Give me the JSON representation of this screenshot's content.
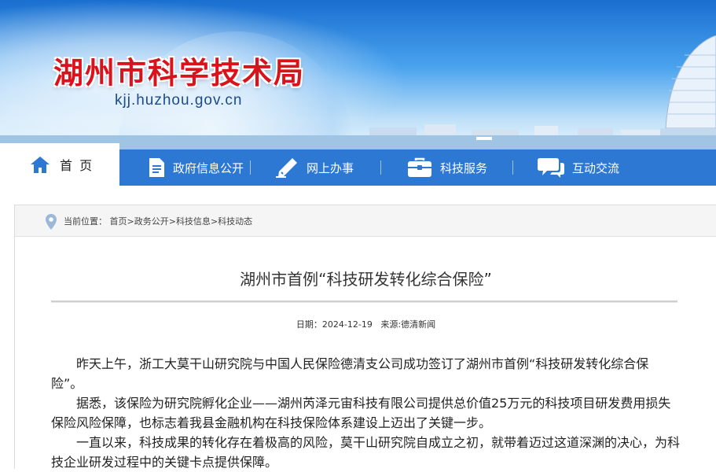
{
  "header": {
    "site_title": "湖州市科学技术局",
    "site_domain": "kjj.huzhou.gov.cn"
  },
  "nav": {
    "items": [
      {
        "label": "首 页",
        "icon": "home-icon"
      },
      {
        "label": "政府信息公开",
        "icon": "document-icon"
      },
      {
        "label": "网上办事",
        "icon": "pen-icon"
      },
      {
        "label": "科技服务",
        "icon": "toolbox-icon"
      },
      {
        "label": "互动交流",
        "icon": "chat-icon"
      }
    ],
    "active_color": "#ffffff",
    "bar_color": "#2d78d2"
  },
  "breadcrumb": {
    "prefix": "当前位置：",
    "items": [
      "首页",
      "政务公开",
      "科技信息",
      "科技动态"
    ],
    "separator": ">"
  },
  "article": {
    "title": "湖州市首例“科技研发转化综合保险”",
    "date_label": "日期：",
    "date": "2024-12-19",
    "source_label": "来源:",
    "source": "德清新闻",
    "paragraphs": [
      "昨天上午，浙工大莫干山研究院与中国人民保险德清支公司成功签订了湖州市首例“科技研发转化综合保险”。",
      "据悉，该保险为研究院孵化企业——湖州芮泽元宙科技有限公司提供总价值25万元的科技项目研发费用损失保险风险保障，也标志着我县金融机构在科技保险体系建设上迈出了关键一步。",
      "一直以来，科技成果的转化存在着极高的风险，莫干山研究院自成立之初，就带着迈过这道深渊的决心，为科技企业研发过程中的关键卡点提供保障。"
    ]
  }
}
